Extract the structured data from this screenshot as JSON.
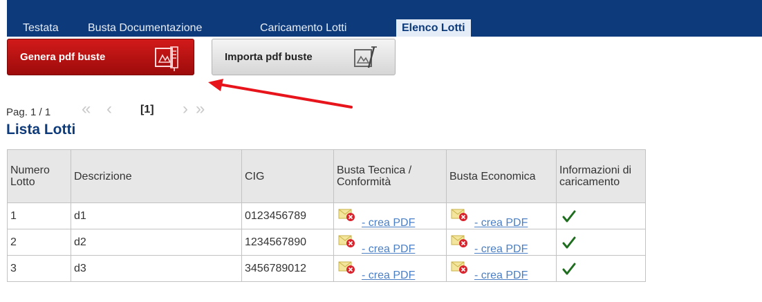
{
  "tabs": [
    {
      "label": "Testata",
      "active": false
    },
    {
      "label": "Busta Documentazione",
      "active": false
    },
    {
      "label": "Caricamento Lotti",
      "active": false
    },
    {
      "label": "Elenco Lotti",
      "active": true
    }
  ],
  "toolbar": {
    "generate_label": "Genera pdf buste",
    "import_label": "Importa pdf buste",
    "generate_icon": "pdf-document-icon",
    "import_icon": "pdf-document-edit-icon"
  },
  "pager": {
    "label": "Pag. 1 / 1",
    "current": "[1]",
    "first_icon": "double-chevron-left-icon",
    "prev_icon": "chevron-left-icon",
    "next_icon": "chevron-right-icon",
    "last_icon": "double-chevron-right-icon"
  },
  "section_title": "Lista Lotti",
  "table": {
    "headers": {
      "numero": "Numero Lotto",
      "descrizione": "Descrizione",
      "cig": "CIG",
      "busta_tecnica": "Busta Tecnica / Conformità",
      "busta_economica": "Busta Economica",
      "informazioni": "Informazioni di caricamento"
    },
    "rows": [
      {
        "numero": "1",
        "descrizione": "d1",
        "cig": "0123456789",
        "tecnica_link": "- crea PDF",
        "economica_link": "- crea PDF"
      },
      {
        "numero": "2",
        "descrizione": "d2",
        "cig": "1234567890",
        "tecnica_link": "- crea PDF",
        "economica_link": "- crea PDF"
      },
      {
        "numero": "3",
        "descrizione": "d3",
        "cig": "3456789012",
        "tecnica_link": "- crea PDF",
        "economica_link": "- crea PDF"
      }
    ],
    "envelope_icon": "envelope-missing-icon",
    "status_icon": "checkmark-icon"
  },
  "colors": {
    "header_bar": "#0d3a7b",
    "generate_button": "#c01414",
    "annotation_arrow": "#e8141b",
    "link": "#4a7fc6"
  }
}
